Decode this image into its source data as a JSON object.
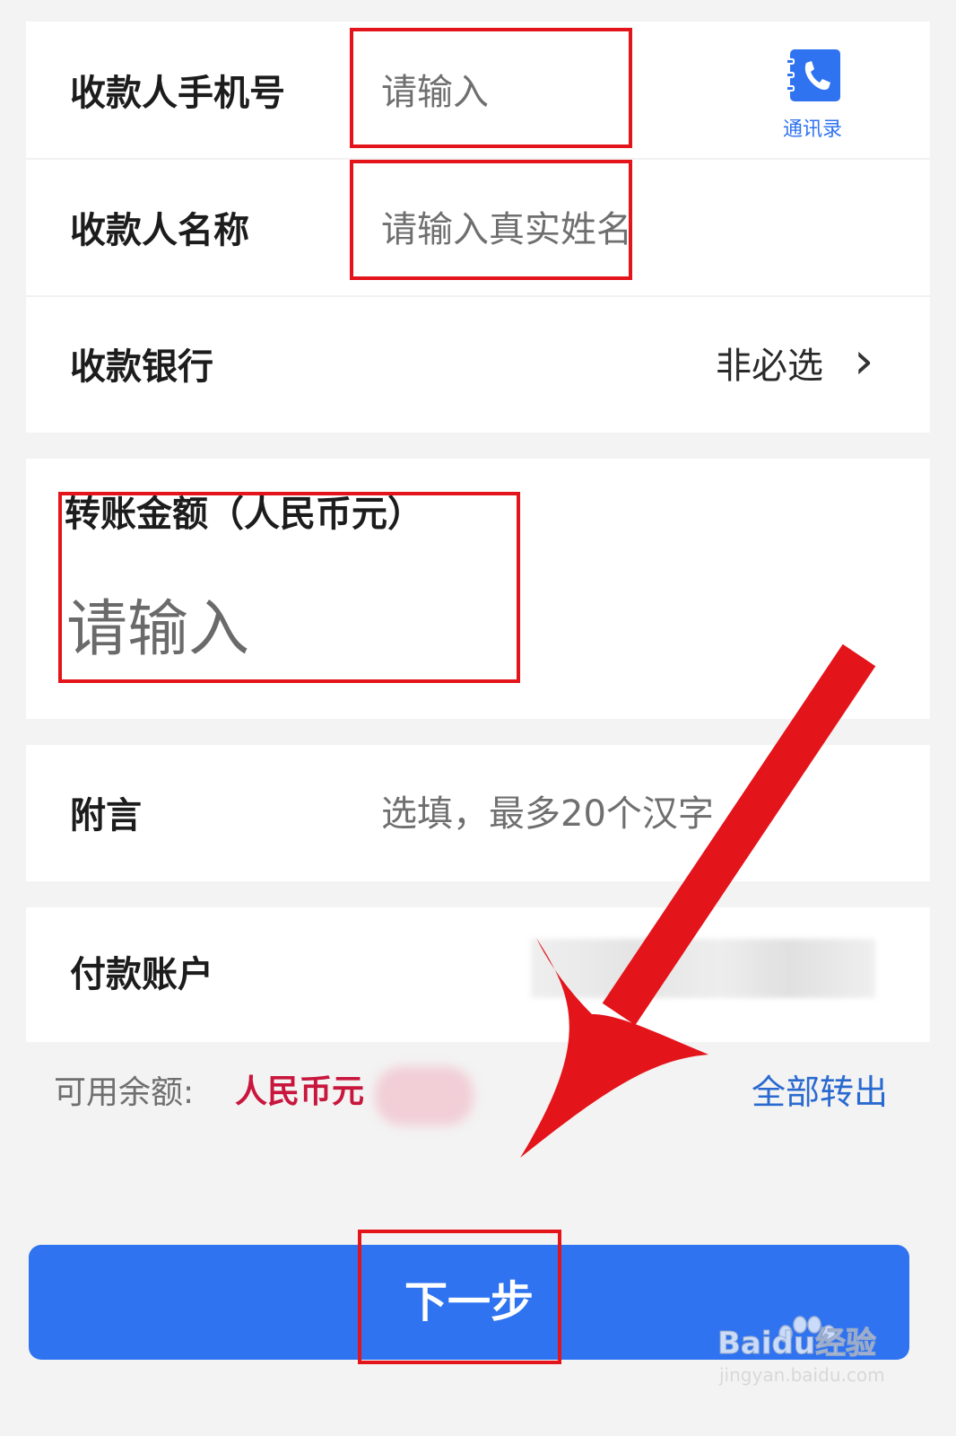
{
  "payee_phone": {
    "label": "收款人手机号",
    "placeholder": "请输入",
    "contacts_label": "通讯录"
  },
  "payee_name": {
    "label": "收款人名称",
    "placeholder": "请输入真实姓名"
  },
  "payee_bank": {
    "label": "收款银行",
    "value": "非必选",
    "chevron": "›"
  },
  "amount": {
    "label": "转账金额（人民币元）",
    "placeholder": "请输入"
  },
  "memo": {
    "label": "附言",
    "placeholder": "选填，最多20个汉字"
  },
  "pay_account": {
    "label": "付款账户"
  },
  "balance": {
    "label": "可用余额:",
    "currency": "人民币元",
    "transfer_all": "全部转出"
  },
  "next_button": {
    "label": "下一步"
  },
  "watermark": {
    "brand_prefix": "Bai",
    "brand_mid": "du",
    "brand_suffix": "经验",
    "url": "jingyan.baidu.com"
  },
  "colors": {
    "accent_blue": "#2f73f0",
    "link_blue": "#2a6ad0",
    "currency_red": "#c8163d",
    "annotation_red": "#e4141b"
  },
  "icons": {
    "contacts": "phone-book-icon",
    "chevron": "chevron-right-icon",
    "annotation": "red-arrow-annotation"
  }
}
